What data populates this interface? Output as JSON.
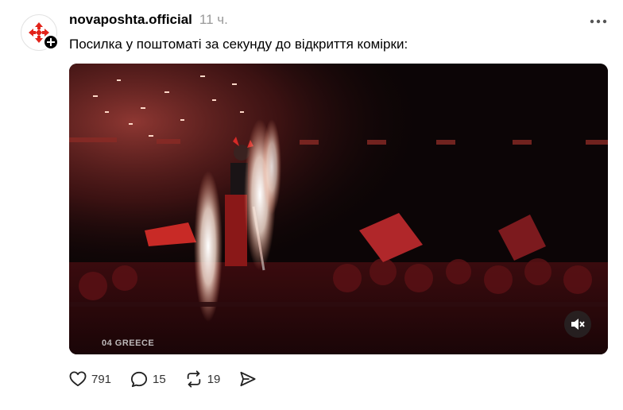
{
  "post": {
    "username": "novaposhta.official",
    "timestamp": "11 ч.",
    "caption": "Посилка у поштоматі за секунду до відкриття комірки:",
    "video_overlay_label": "04 GREECE",
    "stats": {
      "likes": "791",
      "comments": "15",
      "reposts": "19"
    },
    "icons": {
      "avatar": "nova-poshta-logo-icon",
      "follow": "plus-icon",
      "more": "more-dots-icon",
      "mute": "muted-speaker-icon",
      "like": "heart-icon",
      "comment": "comment-bubble-icon",
      "repost": "repost-icon",
      "share": "send-icon"
    },
    "colors": {
      "brand_red": "#e2231a",
      "muted_text": "#999999"
    }
  }
}
